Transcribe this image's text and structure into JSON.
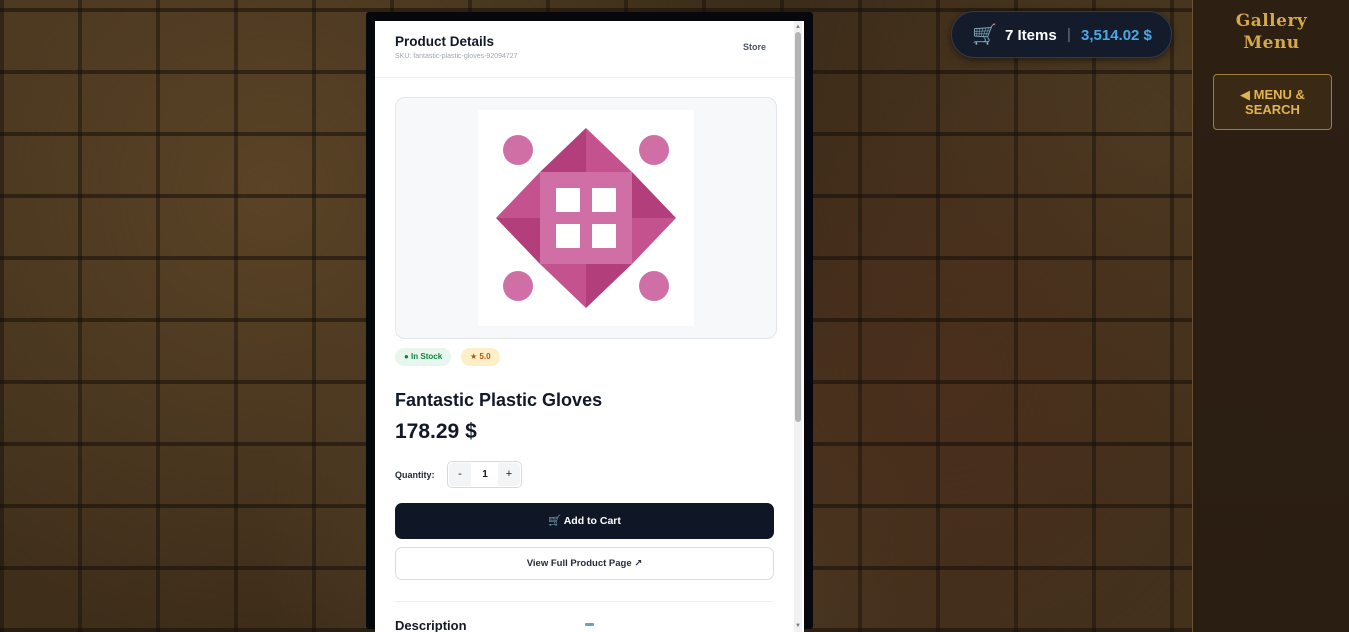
{
  "product_panel": {
    "title": "Product Details",
    "sku": "SKU: fantastic-plastic-gloves-92094727",
    "store_link": "Store",
    "stock_badge": "● In Stock",
    "rating_badge": "★ 5.0",
    "name": "Fantastic Plastic Gloves",
    "price": "178.29 $",
    "quantity_label": "Quantity:",
    "quantity_minus": "-",
    "quantity_value": "1",
    "quantity_plus": "+",
    "add_to_cart": "🛒 Add to Cart",
    "view_full": "View Full Product Page ↗",
    "description_heading": "Description"
  },
  "cart": {
    "icon": "cart-icon",
    "items": "7 Items",
    "separator": "|",
    "total": "3,514.02 $"
  },
  "side_panel": {
    "title_line1": "Gallery",
    "title_line2": "Menu",
    "menu_button": "◀ MENU & SEARCH"
  },
  "colors": {
    "accent_gold": "#d4a94a",
    "cart_total": "#4aa8e8",
    "primary_button": "#0f1726",
    "product_art": "#d06fa6"
  }
}
